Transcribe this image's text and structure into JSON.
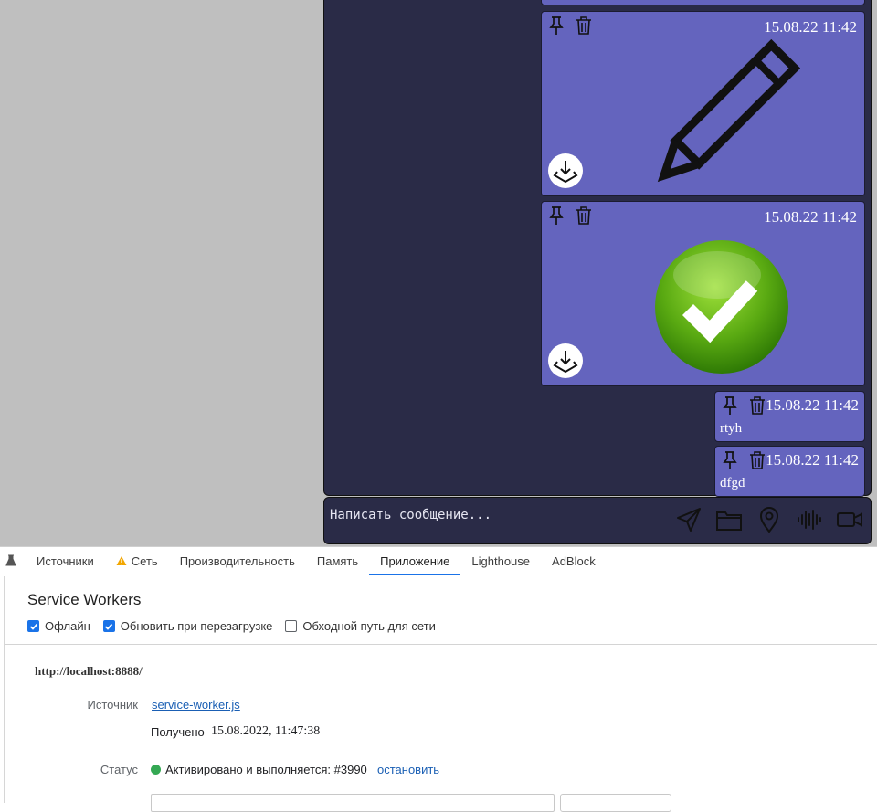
{
  "chat": {
    "messages": [
      {
        "type": "image",
        "image_icon": "pencil-image",
        "time": "15.08.22 11:42"
      },
      {
        "type": "image",
        "image_icon": "green-checkmark-image",
        "time": "15.08.22 11:42"
      },
      {
        "type": "text",
        "time": "15.08.22 11:42",
        "text": "rtyh"
      },
      {
        "type": "text",
        "time": "15.08.22 11:42",
        "text": "dfgd"
      }
    ],
    "composer": {
      "placeholder": "Написать сообщение...",
      "icons": [
        "send-icon",
        "folder-icon",
        "location-icon",
        "audio-wave-icon",
        "video-camera-icon"
      ]
    }
  },
  "devtools": {
    "tabs": [
      "Источники",
      "Сеть",
      "Производительность",
      "Память",
      "Приложение",
      "Lighthouse",
      "AdBlock"
    ],
    "active_tab": "Приложение",
    "network_warning_icon": "warning-icon",
    "section_title": "Service Workers",
    "checkboxes": [
      {
        "label": "Офлайн",
        "checked": true
      },
      {
        "label": "Обновить при перезагрузке",
        "checked": true
      },
      {
        "label": "Обходной путь для сети",
        "checked": false
      }
    ],
    "origin": "http://localhost:8888/",
    "source_label": "Источник",
    "source_link": "service-worker.js",
    "received_label": "Получено",
    "received_value": "15.08.2022, 11:47:38",
    "status_label": "Статус",
    "status_value": "Активировано и выполняется: #3990",
    "status_action": "остановить",
    "status_color": "#34a853"
  }
}
